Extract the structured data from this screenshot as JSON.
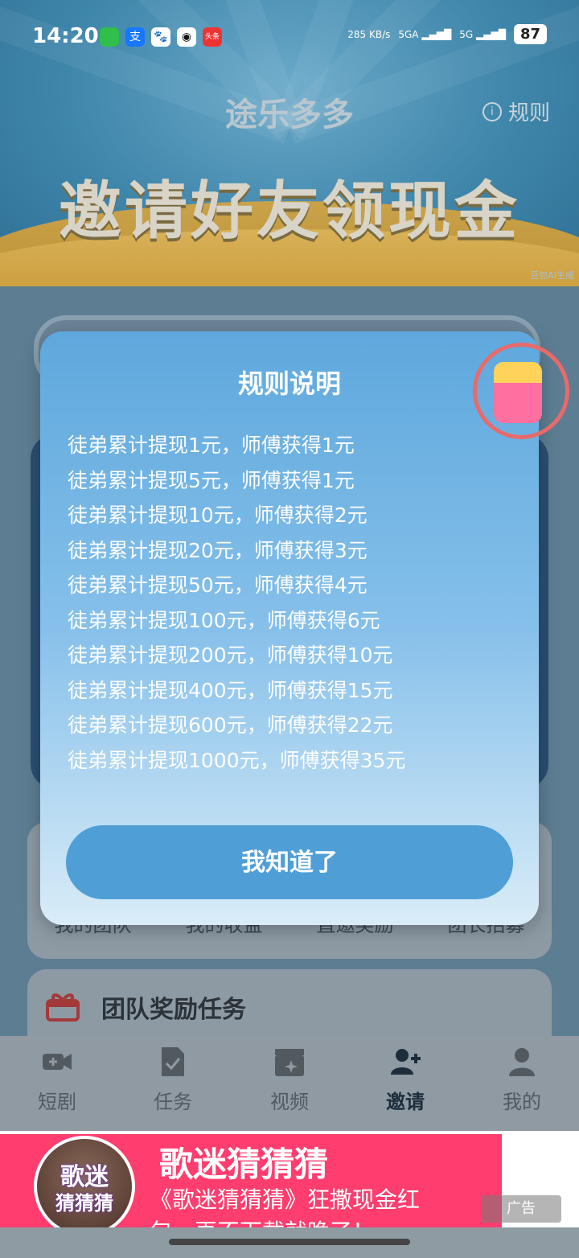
{
  "status_bar": {
    "time": "14:20",
    "net_speed": "285 KB/s",
    "net1": "5GA",
    "net2": "5G",
    "battery": "87"
  },
  "header": {
    "app_title": "途乐多多",
    "rules_link": "规则",
    "banner": "邀请好友领现金",
    "ai_tag": "豆包AI生成"
  },
  "modal": {
    "title": "规则说明",
    "rules": [
      "徒弟累计提现1元，师傅获得1元",
      "徒弟累计提现5元，师傅获得1元",
      "徒弟累计提现10元，师傅获得2元",
      "徒弟累计提现20元，师傅获得3元",
      "徒弟累计提现50元，师傅获得4元",
      "徒弟累计提现100元，师傅获得6元",
      "徒弟累计提现200元，师傅获得10元",
      "徒弟累计提现400元，师傅获得15元",
      "徒弟累计提现600元，师傅获得22元",
      "徒弟累计提现1000元，师傅获得35元"
    ],
    "confirm_button": "我知道了"
  },
  "grid_labels": [
    "我的团队",
    "我的收益",
    "直邀奖励",
    "团长招募"
  ],
  "team_section": {
    "title": "团队奖励任务"
  },
  "tabs": [
    {
      "label": "短剧",
      "icon": "video-camera-icon"
    },
    {
      "label": "任务",
      "icon": "task-doc-icon"
    },
    {
      "label": "视频",
      "icon": "clapper-icon"
    },
    {
      "label": "邀请",
      "icon": "add-user-icon",
      "active": true
    },
    {
      "label": "我的",
      "icon": "person-icon"
    }
  ],
  "ad": {
    "thumb_text_1": "歌迷",
    "thumb_text_2": "猜猜猜",
    "title": "歌迷猜猜猜",
    "subtitle": "《歌迷猜猜猜》狂撒现金红包，再不下载就晚了！",
    "tag": "广告"
  }
}
